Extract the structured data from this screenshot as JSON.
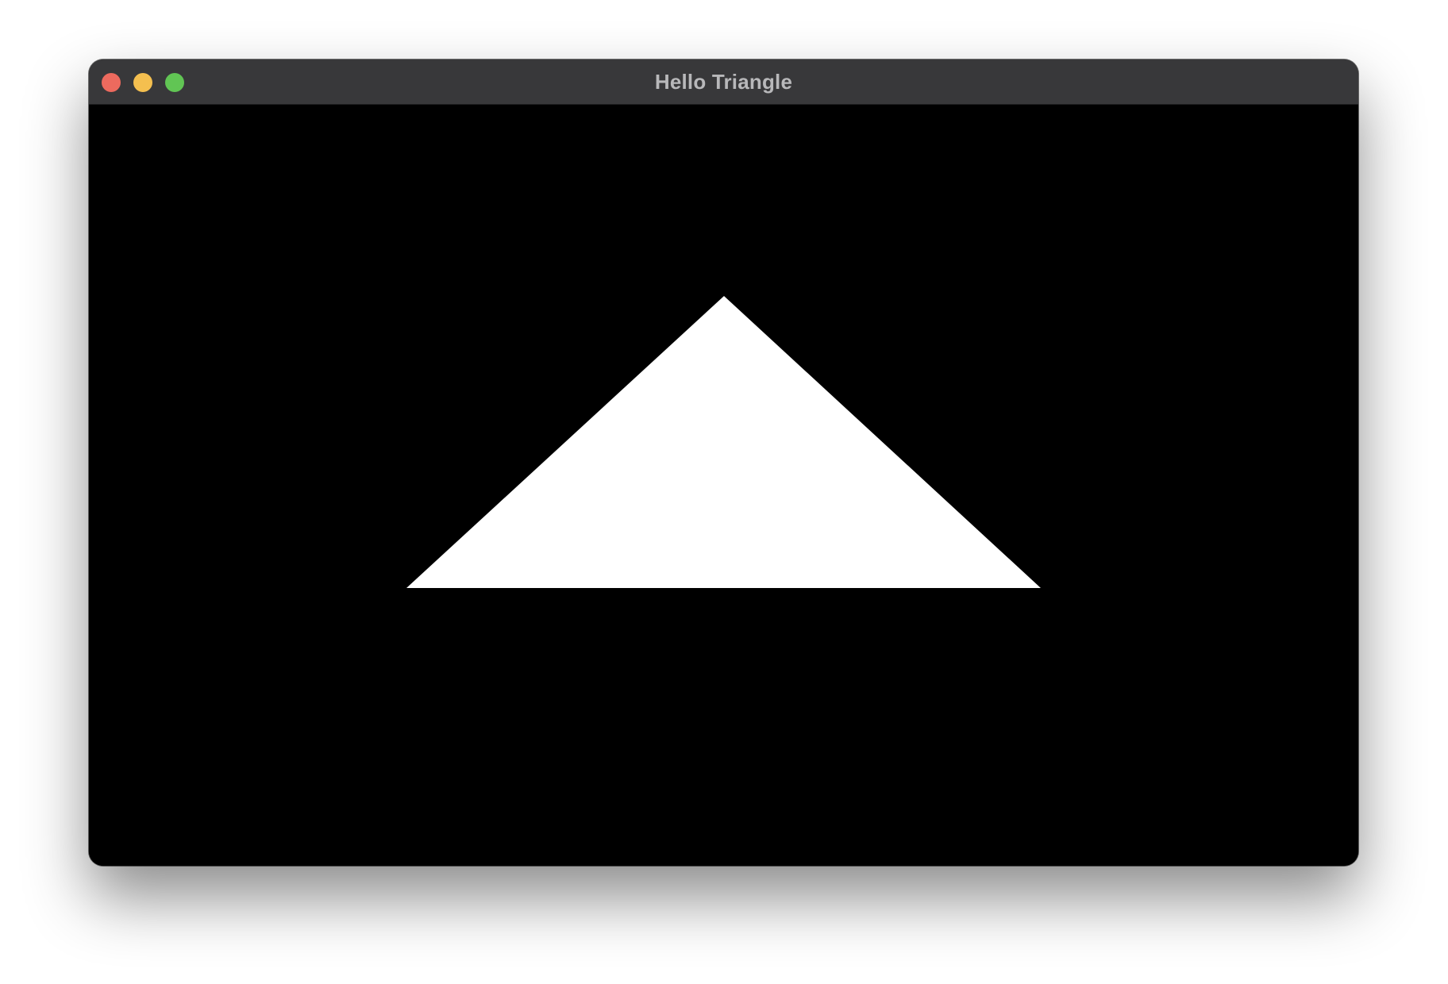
{
  "window": {
    "title": "Hello Triangle",
    "controls": {
      "close_color": "#ed6a5e",
      "minimize_color": "#f4bf4f",
      "zoom_color": "#61c554"
    }
  },
  "canvas": {
    "background_color": "#000000",
    "shape": "triangle",
    "shape_color": "#ffffff"
  }
}
